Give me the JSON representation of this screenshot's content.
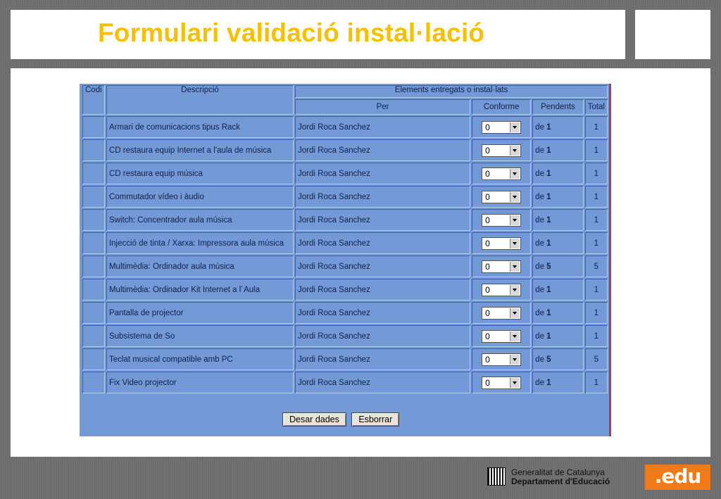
{
  "slide": {
    "title": "Formulari validació instal·lació"
  },
  "table": {
    "headers": {
      "codi": "Codi",
      "descripcio": "Descripció",
      "elements": "Elements entregats o instal·lats",
      "per": "Per",
      "conforme": "Conforme",
      "pendents": "Pendents",
      "total": "Total"
    },
    "rows": [
      {
        "descripcio": "Armari de comunicacions tipus Rack",
        "per": "Jordi Roca Sanchez",
        "conforme": "0",
        "pend_prefix": "de",
        "pend_count": "1",
        "total": "1"
      },
      {
        "descripcio": "CD restaura equip Internet a l'aula de música",
        "per": "Jordi Roca Sanchez",
        "conforme": "0",
        "pend_prefix": "de",
        "pend_count": "1",
        "total": "1"
      },
      {
        "descripcio": "CD restaura equip música",
        "per": "Jordi Roca Sanchez",
        "conforme": "0",
        "pend_prefix": "de",
        "pend_count": "1",
        "total": "1"
      },
      {
        "descripcio": "Commutador vídeo i àudio",
        "per": "Jordi Roca Sanchez",
        "conforme": "0",
        "pend_prefix": "de",
        "pend_count": "1",
        "total": "1"
      },
      {
        "descripcio": "Switch: Concentrador aula música",
        "per": "Jordi Roca Sanchez",
        "conforme": "0",
        "pend_prefix": "de",
        "pend_count": "1",
        "total": "1"
      },
      {
        "descripcio": "Injecció de tinta / Xarxa: Impressora aula música",
        "per": "Jordi Roca Sanchez",
        "conforme": "0",
        "pend_prefix": "de",
        "pend_count": "1",
        "total": "1"
      },
      {
        "descripcio": "Multimèdia: Ordinador aula música",
        "per": "Jordi Roca Sanchez",
        "conforme": "0",
        "pend_prefix": "de",
        "pend_count": "5",
        "total": "5"
      },
      {
        "descripcio": "Multimèdia: Ordinador Kit Internet a l´Aula",
        "per": "Jordi Roca Sanchez",
        "conforme": "0",
        "pend_prefix": "de",
        "pend_count": "1",
        "total": "1"
      },
      {
        "descripcio": "Pantalla de projector",
        "per": "Jordi Roca Sanchez",
        "conforme": "0",
        "pend_prefix": "de",
        "pend_count": "1",
        "total": "1"
      },
      {
        "descripcio": "Subsistema de So",
        "per": "Jordi Roca Sanchez",
        "conforme": "0",
        "pend_prefix": "de",
        "pend_count": "1",
        "total": "1"
      },
      {
        "descripcio": "Teclat musical compatible amb PC",
        "per": "Jordi Roca Sanchez",
        "conforme": "0",
        "pend_prefix": "de",
        "pend_count": "5",
        "total": "5"
      },
      {
        "descripcio": "Fix Video projector",
        "per": "Jordi Roca Sanchez",
        "conforme": "0",
        "pend_prefix": "de",
        "pend_count": "1",
        "total": "1"
      }
    ]
  },
  "buttons": {
    "save": "Desar dades",
    "clear": "Esborrar"
  },
  "footer": {
    "org_line1": "Generalitat de Catalunya",
    "org_line2": "Departament d'Educació",
    "badge": ".edu",
    "logo_icon": "generalitat-logo-icon"
  },
  "colors": {
    "title": "#f5c000",
    "panel": "#739ad6",
    "badge": "#f07a1a"
  }
}
